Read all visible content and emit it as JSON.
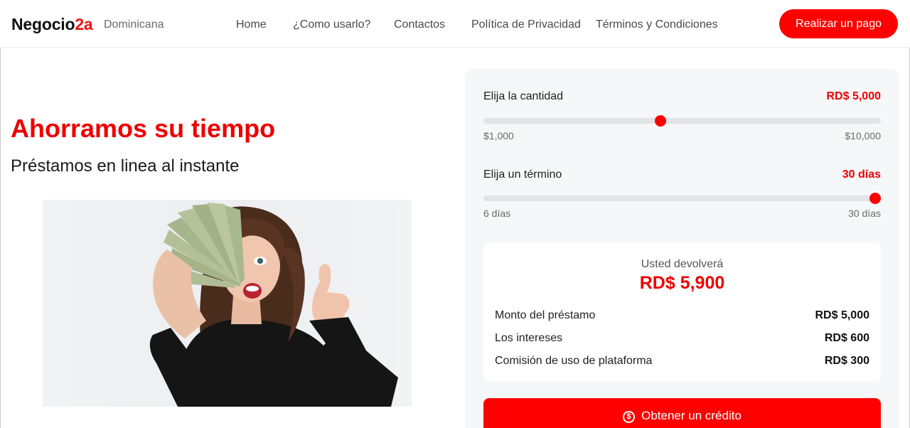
{
  "header": {
    "logo_main": "Negocio",
    "logo_accent": "2a",
    "logo_sub": "Dominicana",
    "nav": [
      "Home",
      "¿Como usarlo?",
      "Contactos",
      "Política de Privacidad",
      "Términos y Condiciones"
    ],
    "pay_button": "Realizar un pago"
  },
  "hero": {
    "title": "Ahorramos su tiempo",
    "subtitle": "Préstamos en linea al instante"
  },
  "calculator": {
    "amount": {
      "label": "Elija la cantidad",
      "value": "RD$ 5,000",
      "min": "$1,000",
      "max": "$10,000",
      "level": 0.444
    },
    "term": {
      "label": "Elija un término",
      "value": "30 días",
      "min": "6 días",
      "max": "30 días",
      "level": 1.0
    },
    "summary": {
      "caption": "Usted devolverá",
      "total": "RD$ 5,900",
      "rows": [
        {
          "label": "Monto del préstamo",
          "value": "RD$ 5,000"
        },
        {
          "label": "Los intereses",
          "value": "RD$ 600"
        },
        {
          "label": "Comisión de uso de plataforma",
          "value": "RD$ 300"
        }
      ]
    },
    "submit": "Obtener un crédito",
    "submit_icon": "dollar-circle-icon"
  },
  "colors": {
    "accent": "#ff0000",
    "card_bg": "#f6f7f9"
  }
}
